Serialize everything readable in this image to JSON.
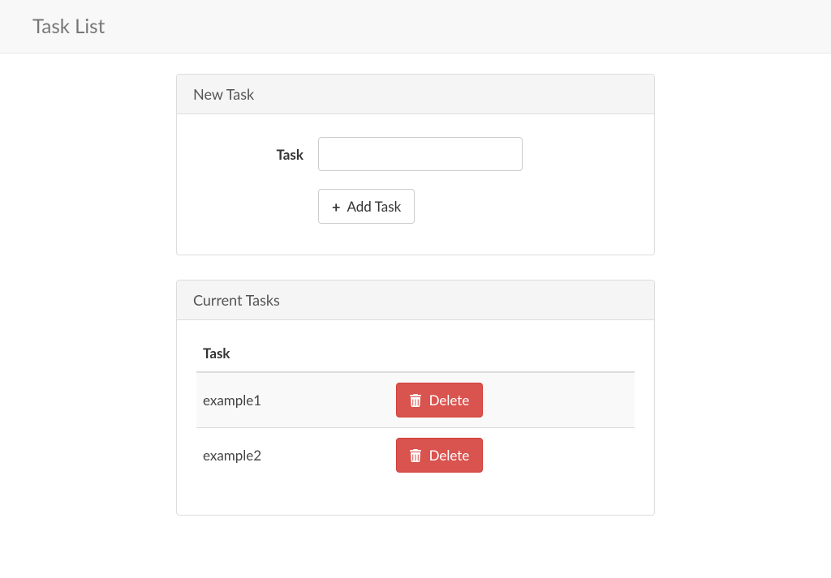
{
  "navbar": {
    "brand": "Task List"
  },
  "newTaskPanel": {
    "heading": "New Task",
    "form": {
      "label": "Task",
      "value": "",
      "addButtonLabel": "Add Task"
    }
  },
  "currentTasksPanel": {
    "heading": "Current Tasks",
    "table": {
      "header": "Task",
      "deleteLabel": "Delete",
      "rows": [
        {
          "name": "example1"
        },
        {
          "name": "example2"
        }
      ]
    }
  }
}
